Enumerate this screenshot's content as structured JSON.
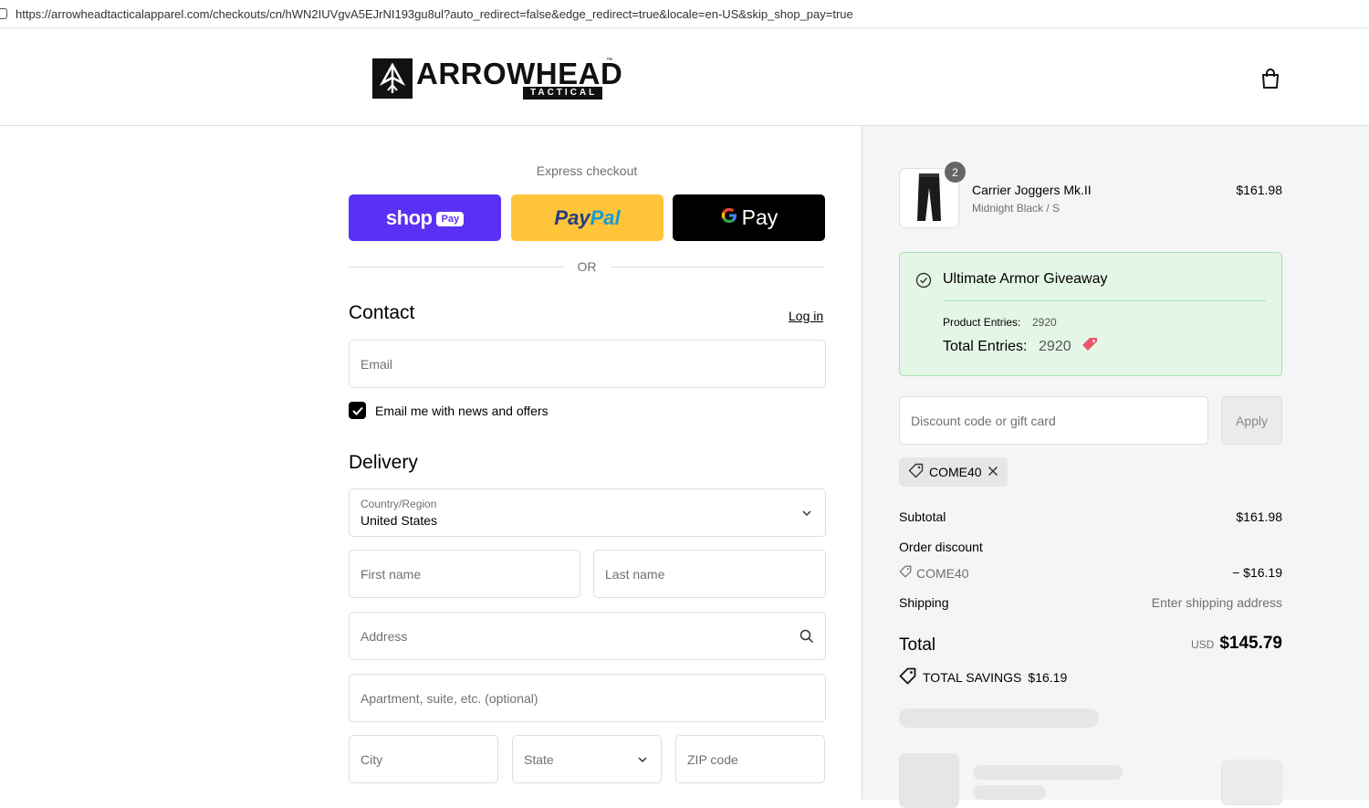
{
  "browser": {
    "url": "https://arrowheadtacticalapparel.com/checkouts/cn/hWN2IUVgvA5EJrNI193gu8ul?auto_redirect=false&edge_redirect=true&locale=en-US&skip_shop_pay=true"
  },
  "header": {
    "logo_text": "ARROWHEAD",
    "logo_sub": "TACTICAL",
    "logo_tm": "™",
    "cart_icon": "shopping-bag-icon"
  },
  "express": {
    "label": "Express checkout",
    "shoppay": {
      "word": "shop",
      "badge": "Pay"
    },
    "paypal": {
      "part1": "Pay",
      "part2": "Pal"
    },
    "gpay": {
      "g": "G",
      "word": "Pay"
    },
    "or": "OR"
  },
  "contact": {
    "heading": "Contact",
    "login": "Log in",
    "email_placeholder": "Email",
    "newsletter_label": "Email me with news and offers",
    "newsletter_checked": true
  },
  "delivery": {
    "heading": "Delivery",
    "country_label": "Country/Region",
    "country_value": "United States",
    "first_name": "First name",
    "last_name": "Last name",
    "address": "Address",
    "apartment": "Apartment, suite, etc. (optional)",
    "city": "City",
    "state": "State",
    "zip": "ZIP code"
  },
  "summary": {
    "product": {
      "name": "Carrier Joggers Mk.II",
      "variant": "Midnight Black / S",
      "price": "$161.98",
      "quantity": "2"
    },
    "giveaway": {
      "title": "Ultimate Armor Giveaway",
      "product_entries_label": "Product Entries:",
      "product_entries_value": "2920",
      "total_entries_label": "Total Entries:",
      "total_entries_value": "2920"
    },
    "discount_placeholder": "Discount code or gift card",
    "apply": "Apply",
    "applied_code": "COME40",
    "subtotal_label": "Subtotal",
    "subtotal_value": "$161.98",
    "order_discount_label": "Order discount",
    "discount_code": "COME40",
    "discount_value": "− $16.19",
    "shipping_label": "Shipping",
    "shipping_value": "Enter shipping address",
    "total_label": "Total",
    "currency": "USD",
    "total_value": "$145.79",
    "savings_label": "TOTAL SAVINGS",
    "savings_value": "$16.19"
  },
  "colors": {
    "shoppay": "#5a31f4",
    "paypal": "#ffc439",
    "gpay": "#000000",
    "giveaway_bg": "#e4f7e6",
    "accent_tag": "#e85a6a"
  }
}
